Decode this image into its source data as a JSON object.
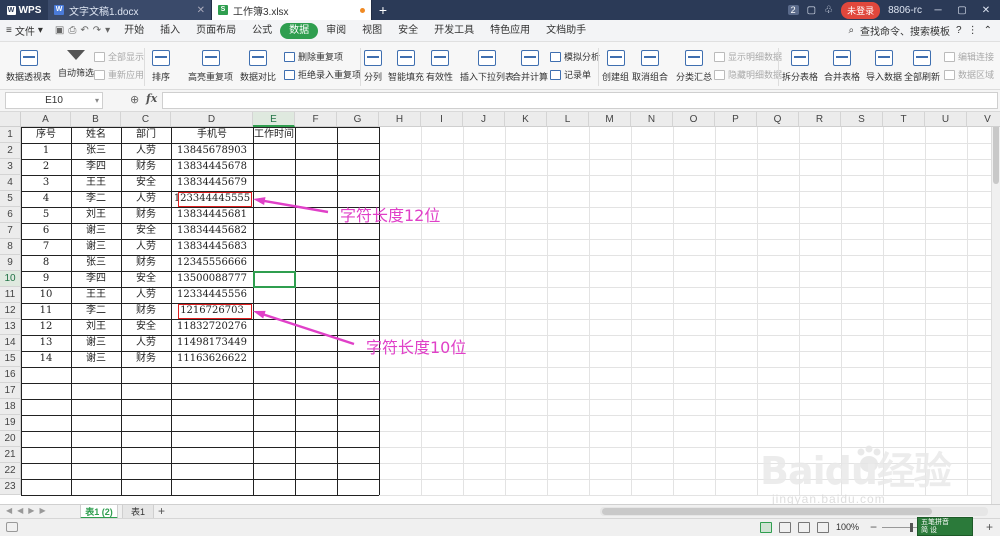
{
  "titlebar": {
    "app_name": "WPS",
    "tabs": [
      {
        "label": "文字文稿1.docx",
        "type": "doc"
      },
      {
        "label": "工作簿3.xlsx",
        "type": "sheet"
      }
    ],
    "new_tab": "+",
    "badge": "2",
    "login": "未登录",
    "user": "8806-rc"
  },
  "menubar": {
    "file": "文件",
    "items": [
      "开始",
      "插入",
      "页面布局",
      "公式",
      "数据",
      "审阅",
      "视图",
      "安全",
      "开发工具",
      "特色应用",
      "文档助手"
    ],
    "active": "数据",
    "search": "查找命令、搜索模板"
  },
  "toolbar": {
    "pivot": "数据透视表",
    "autofilter": "自动筛选",
    "show_all": "全部显示",
    "reapply": "重新应用",
    "sort": "排序",
    "highlight_dup": "高亮重复项",
    "data_compare": "数据对比",
    "remove_dup": "删除重复项",
    "reject_dup": "拒绝录入重复项",
    "split": "分列",
    "smart_fill": "智能填充",
    "validity": "有效性",
    "insert_dropdown": "插入下拉列表",
    "merge_calc": "合并计算",
    "sim_analysis": "模拟分析",
    "record_form": "记录单",
    "create_group": "创建组",
    "ungroup": "取消组合",
    "subtotal": "分类汇总",
    "show_detail": "显示明细数据",
    "hide_detail": "隐藏明细数据",
    "split_table": "拆分表格",
    "merge_table": "合并表格",
    "import_data": "导入数据",
    "refresh_all": "全部刷新",
    "edit_link": "编辑连接",
    "data_area": "数据区域"
  },
  "formulabar": {
    "cell_ref": "E10",
    "fx": "fx",
    "value": ""
  },
  "sheet": {
    "columns": [
      "A",
      "B",
      "C",
      "D",
      "E",
      "F",
      "G",
      "H",
      "I",
      "J",
      "K",
      "L",
      "M",
      "N",
      "O",
      "P",
      "Q",
      "R",
      "S",
      "T",
      "U",
      "V"
    ],
    "rows": [
      "1",
      "2",
      "3",
      "4",
      "5",
      "6",
      "7",
      "8",
      "9",
      "10",
      "11",
      "12",
      "13",
      "14",
      "15",
      "16",
      "17",
      "18",
      "19",
      "20",
      "21",
      "22",
      "23"
    ],
    "headers": [
      "序号",
      "姓名",
      "部门",
      "手机号",
      "工作时间"
    ],
    "data": [
      [
        "1",
        "张三",
        "人劳",
        "13845678903",
        ""
      ],
      [
        "2",
        "李四",
        "财务",
        "13834445678",
        ""
      ],
      [
        "3",
        "王王",
        "安全",
        "13834445679",
        ""
      ],
      [
        "4",
        "李二",
        "人劳",
        "123344445555",
        ""
      ],
      [
        "5",
        "刘王",
        "财务",
        "13834445681",
        ""
      ],
      [
        "6",
        "谢三",
        "安全",
        "13834445682",
        ""
      ],
      [
        "7",
        "谢三",
        "人劳",
        "13834445683",
        ""
      ],
      [
        "8",
        "张三",
        "财务",
        "12345556666",
        ""
      ],
      [
        "9",
        "李四",
        "安全",
        "13500088777",
        ""
      ],
      [
        "10",
        "王王",
        "人劳",
        "12334445556",
        ""
      ],
      [
        "11",
        "李二",
        "财务",
        "1216726703",
        ""
      ],
      [
        "12",
        "刘王",
        "安全",
        "11832720276",
        ""
      ],
      [
        "13",
        "谢三",
        "人劳",
        "11498173449",
        ""
      ],
      [
        "14",
        "谢三",
        "财务",
        "11163626622",
        ""
      ]
    ],
    "annotations": [
      {
        "text": "字符长度12位"
      },
      {
        "text": "字符长度10位"
      }
    ]
  },
  "sheet_tabs": {
    "tabs": [
      "表1 (2)",
      "表1"
    ],
    "active": "表1 (2)",
    "add": "+"
  },
  "statusbar": {
    "zoom": "100%",
    "ime_line1": "五笔拼音",
    "ime_line2": "简  设"
  },
  "watermark": {
    "main": "Baidu经验",
    "sub": "jingyan.baidu.com"
  },
  "colors": {
    "accent": "#2f9e4f",
    "annotation": "#e040c8",
    "highlight_box": "#e02020",
    "titlebar": "#2b3a57"
  }
}
